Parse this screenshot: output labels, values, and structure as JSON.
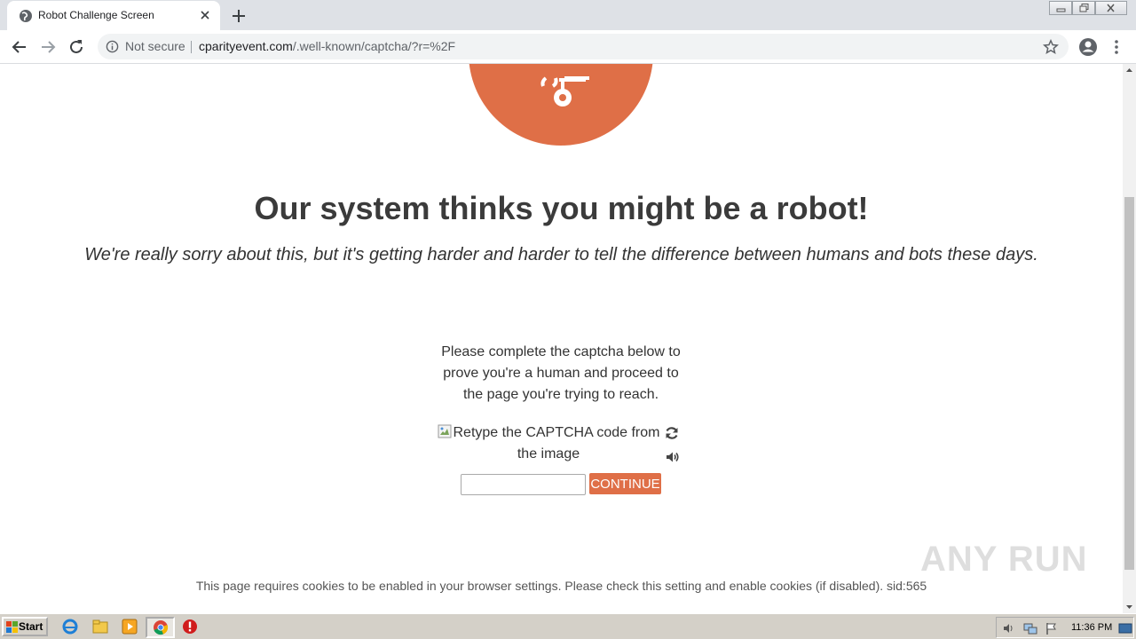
{
  "browser": {
    "tab_title": "Robot Challenge Screen",
    "security_label": "Not secure",
    "url_host": "cparityevent.com",
    "url_path": "/.well-known/captcha/?r=%2F"
  },
  "page": {
    "headline": "Our system thinks you might be a robot!",
    "subheadline": "We're really sorry about this, but it's getting harder and harder to tell the difference between humans and bots these days.",
    "instructions": "Please complete the captcha below to prove you're a human and proceed to the page you're trying to reach.",
    "captcha_alt": "Retype the CAPTCHA code from the image",
    "captcha_value": "",
    "continue_label": "CONTINUE",
    "cookie_notice": "This page requires cookies to be enabled in your browser settings. Please check this setting and enable cookies (if disabled). sid:565",
    "accent_color": "#df6f47"
  },
  "watermark": "ANY RUN",
  "taskbar": {
    "start_label": "Start",
    "clock": "11:36 PM"
  }
}
